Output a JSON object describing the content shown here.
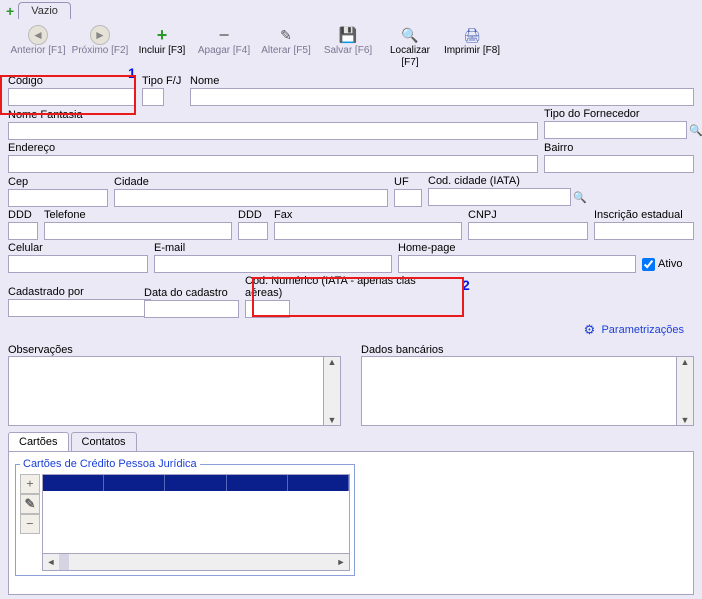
{
  "tab": {
    "label": "Vazio"
  },
  "toolbar": [
    {
      "label": "Anterior [F1]",
      "enabled": false,
      "icon": "arrow-left"
    },
    {
      "label": "Próximo [F2]",
      "enabled": false,
      "icon": "arrow-right"
    },
    {
      "label": "Incluir [F3]",
      "enabled": true,
      "icon": "plus"
    },
    {
      "label": "Apagar [F4]",
      "enabled": false,
      "icon": "minus"
    },
    {
      "label": "Alterar [F5]",
      "enabled": false,
      "icon": "edit"
    },
    {
      "label": "Salvar [F6]",
      "enabled": false,
      "icon": "save"
    },
    {
      "label": "Localizar [F7]",
      "enabled": true,
      "icon": "search"
    },
    {
      "label": "Imprimir [F8]",
      "enabled": true,
      "icon": "print"
    }
  ],
  "callouts": {
    "one": "1",
    "two": "2"
  },
  "fields": {
    "codigo": {
      "label": "Código",
      "value": ""
    },
    "tipofj": {
      "label": "Tipo F/J",
      "value": ""
    },
    "nome": {
      "label": "Nome",
      "value": ""
    },
    "nomefantasia": {
      "label": "Nome Fantasia",
      "value": ""
    },
    "tipofornecedor": {
      "label": "Tipo do Fornecedor",
      "value": ""
    },
    "endereco": {
      "label": "Endereço",
      "value": ""
    },
    "bairro": {
      "label": "Bairro",
      "value": ""
    },
    "cep": {
      "label": "Cep",
      "value": ""
    },
    "cidade": {
      "label": "Cidade",
      "value": ""
    },
    "uf": {
      "label": "UF",
      "value": ""
    },
    "codcidadeiata": {
      "label": "Cod. cidade (IATA)",
      "value": ""
    },
    "ddd1": {
      "label": "DDD",
      "value": ""
    },
    "telefone": {
      "label": "Telefone",
      "value": ""
    },
    "ddd2": {
      "label": "DDD",
      "value": ""
    },
    "fax": {
      "label": "Fax",
      "value": ""
    },
    "cnpj": {
      "label": "CNPJ",
      "value": ""
    },
    "inscest": {
      "label": "Inscrição estadual",
      "value": ""
    },
    "celular": {
      "label": "Celular",
      "value": ""
    },
    "email": {
      "label": "E-mail",
      "value": ""
    },
    "homepage": {
      "label": "Home-page",
      "value": ""
    },
    "ativo": {
      "label": "Ativo",
      "checked": true
    },
    "cadastradopor": {
      "label": "Cadastrado por",
      "value": ""
    },
    "datacadastro": {
      "label": "Data do cadastro",
      "value": ""
    },
    "codnumericoiata": {
      "label": "Cod. Numérico (IATA - apenas cias aéreas)",
      "value": ""
    }
  },
  "links": {
    "parametrizacoes": "Parametrizações"
  },
  "sections": {
    "observacoes": "Observações",
    "dadosbancarios": "Dados bancários"
  },
  "bottomTabs": [
    {
      "label": "Cartões"
    },
    {
      "label": "Contatos"
    }
  ],
  "groupbox": {
    "legend": "Cartões de Crédito Pessoa Jurídica"
  }
}
